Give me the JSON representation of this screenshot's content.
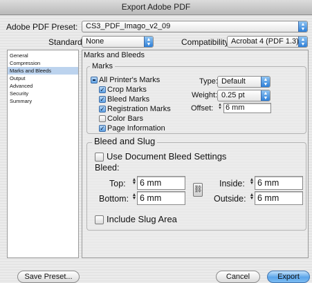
{
  "window": {
    "title": "Export Adobe PDF"
  },
  "preset": {
    "label": "Adobe PDF Preset:",
    "value": "CS3_PDF_Imago_v2_09"
  },
  "standard": {
    "label": "Standard:",
    "value": "None"
  },
  "compatibility": {
    "label": "Compatibility:",
    "value": "Acrobat 4 (PDF 1.3)"
  },
  "sidebar": {
    "items": [
      {
        "label": "General"
      },
      {
        "label": "Compression"
      },
      {
        "label": "Marks and Bleeds",
        "selected": true
      },
      {
        "label": "Output"
      },
      {
        "label": "Advanced"
      },
      {
        "label": "Security"
      },
      {
        "label": "Summary"
      }
    ]
  },
  "panel": {
    "heading": "Marks and Bleeds"
  },
  "marks": {
    "group_title": "Marks",
    "all_printers_marks": "All Printer's Marks",
    "crop_marks": "Crop Marks",
    "bleed_marks": "Bleed Marks",
    "registration_marks": "Registration Marks",
    "color_bars": "Color Bars",
    "page_information": "Page Information",
    "type_label": "Type:",
    "type_value": "Default",
    "weight_label": "Weight:",
    "weight_value": "0.25 pt",
    "offset_label": "Offset:",
    "offset_value": "6 mm"
  },
  "bleed": {
    "group_title": "Bleed and Slug",
    "use_document": "Use Document Bleed Settings",
    "bleed_label": "Bleed:",
    "top_label": "Top:",
    "top_value": "6 mm",
    "bottom_label": "Bottom:",
    "bottom_value": "6 mm",
    "inside_label": "Inside:",
    "inside_value": "6 mm",
    "outside_label": "Outside:",
    "outside_value": "6 mm",
    "include_slug": "Include Slug Area"
  },
  "buttons": {
    "save_preset": "Save Preset...",
    "cancel": "Cancel",
    "export": "Export"
  },
  "colors": {
    "accent": "#3c8ae0",
    "selection": "#bcd3ee"
  }
}
